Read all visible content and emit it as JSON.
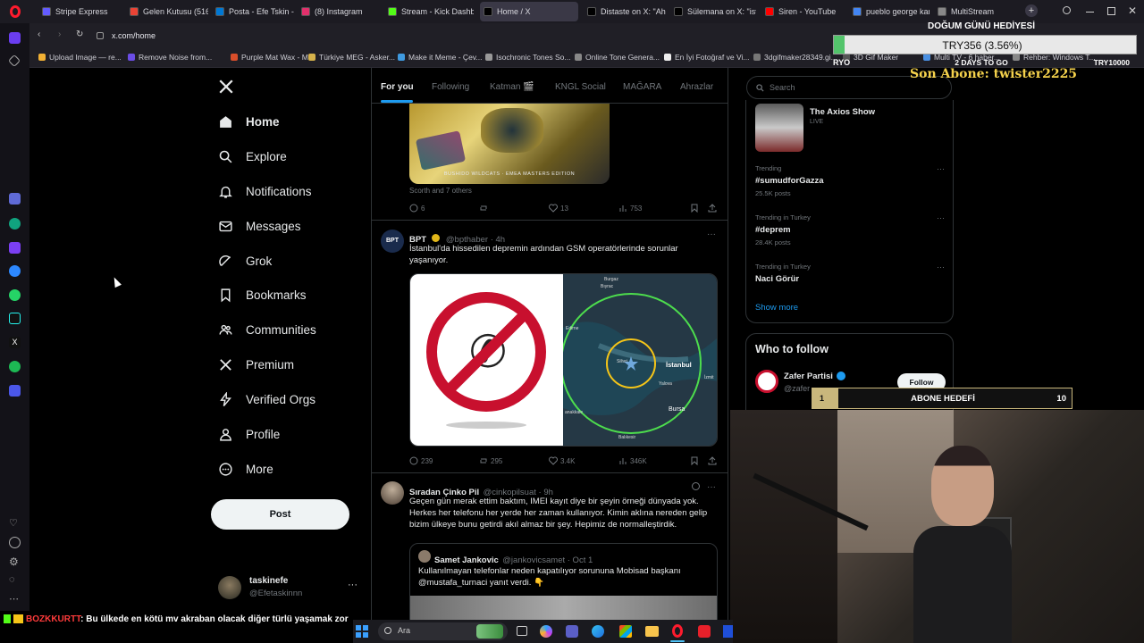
{
  "browser": {
    "tabs": [
      {
        "title": "Stripe Express",
        "color": "#635bff"
      },
      {
        "title": "Gelen Kutusu (516) -",
        "color": "#ea4335"
      },
      {
        "title": "Posta - Efe Tskin - Ou",
        "color": "#0078d4"
      },
      {
        "title": "(8) Instagram",
        "color": "#e1306c"
      },
      {
        "title": "Stream - Kick Dashbo",
        "color": "#53fc18"
      },
      {
        "title": "Home / X",
        "color": "#000000"
      },
      {
        "title": "Distaste on X: \"Ahmet",
        "color": "#000000"
      },
      {
        "title": "Sülemana on X: \"istec",
        "color": "#000000"
      },
      {
        "title": "Siren - YouTube",
        "color": "#ff0000"
      },
      {
        "title": "pueblo george karelis",
        "color": "#4285f4"
      },
      {
        "title": "MultiStream",
        "color": "#888888"
      }
    ],
    "url": "x.com/home",
    "bookmarks": [
      "Upload Image — re...",
      "Remove Noise from...",
      "Purple Mat Wax - M...",
      "Türkiye MEG - Asker...",
      "Make it Meme - Çev...",
      "Isochronic Tones So...",
      "Online Tone Genera...",
      "En İyi Fotoğraf ve Vi...",
      "3dgifmaker28349.gi...",
      "3D Gif Maker",
      "Multi TV - 6 haber...",
      "Rehber: Windows T..."
    ]
  },
  "nav": {
    "items": [
      {
        "label": "Home",
        "icon": "home-icon"
      },
      {
        "label": "Explore",
        "icon": "search-icon"
      },
      {
        "label": "Notifications",
        "icon": "bell-icon"
      },
      {
        "label": "Messages",
        "icon": "mail-icon"
      },
      {
        "label": "Grok",
        "icon": "grok-icon"
      },
      {
        "label": "Bookmarks",
        "icon": "bookmark-icon"
      },
      {
        "label": "Communities",
        "icon": "communities-icon"
      },
      {
        "label": "Premium",
        "icon": "x-logo-icon"
      },
      {
        "label": "Verified Orgs",
        "icon": "lightning-icon"
      },
      {
        "label": "Profile",
        "icon": "person-icon"
      },
      {
        "label": "More",
        "icon": "more-circle-icon"
      }
    ],
    "post_label": "Post",
    "account_name": "taskinefe",
    "account_handle": "@Efetaskinnn"
  },
  "feed": {
    "tabs": [
      "For you",
      "Following",
      "Katman 🎬",
      "KNGL Social",
      "MAĞARA",
      "Ahrazlar"
    ],
    "first_tweet": {
      "image_caption": "BUSHIDO WILDCATS · EMEA MASTERS EDITION",
      "tagged": "Scorth and 7 others",
      "replies": "6",
      "likes": "13",
      "views": "753"
    },
    "bpt_tweet": {
      "name": "BPT",
      "handle": "@bpthaber · 4h",
      "text": "İstanbul'da hissedilen depremin ardından GSM operatörlerinde sorunlar yaşanıyor.",
      "map_labels": [
        "Burgaz",
        "Bıyrac",
        "Edirne",
        "Silivri",
        "İstanbul",
        "Yalova",
        "İzmit",
        "Bursa",
        "Balıkesir",
        "anakkale"
      ],
      "replies": "239",
      "reposts": "295",
      "likes": "3.4K",
      "views": "346K"
    },
    "third_tweet": {
      "name": "Sıradan Çinko Pil",
      "handle": "@cinkopilsuat · 9h",
      "text": "Geçen gün merak ettim baktım, IMEI kayıt diye bir şeyin örneği dünyada yok. Herkes her telefonu her yerde her zaman kullanıyor. Kimin aklına nereden gelip bizim ülkeye bunu getirdi akıl almaz bir şey. Hepimiz de normalleştirdik.",
      "quote_name": "Samet Jankovic",
      "quote_handle": "@jankovicsamet · Oct 1",
      "quote_text": "Kullanılmayan telefonlar neden kapatılıyor sorununa Mobisad başkanı @mustafa_turnaci yanıt verdi. 👇"
    }
  },
  "right": {
    "search_placeholder": "Search",
    "live": {
      "title": "The Axios Show",
      "status": "LIVE"
    },
    "trends": [
      {
        "meta": "Trending",
        "name": "#sumudforGazza",
        "posts": "25.5K posts"
      },
      {
        "meta": "Trending in Turkey",
        "name": "#deprem",
        "posts": "28.4K posts"
      },
      {
        "meta": "Trending in Turkey",
        "name": "Naci Görür",
        "posts": ""
      }
    ],
    "show_more": "Show more",
    "who_to_follow": "Who to follow",
    "suggestion": {
      "name": "Zafer Partisi",
      "handle": "@zafer",
      "follow": "Follow"
    }
  },
  "overlay": {
    "goal_title": "DOĞUM GÜNÜ HEDİYESİ",
    "goal_value": "TRY356 (3.56%)",
    "goal_left": "RYO",
    "goal_mid": "2 DAYS TO GO",
    "goal_right": "TRY10000",
    "last_sub": "Son Abone: twister2225",
    "sub_goal_current": "1",
    "sub_goal_label": "ABONE HEDEFİ",
    "sub_goal_target": "10",
    "chat_user": "BOZKKURTT",
    "chat_text": ": Bu ülkede en kötü mv akraban olacak diğer türlü yaşamak zor"
  },
  "taskbar": {
    "search": "Ara"
  }
}
